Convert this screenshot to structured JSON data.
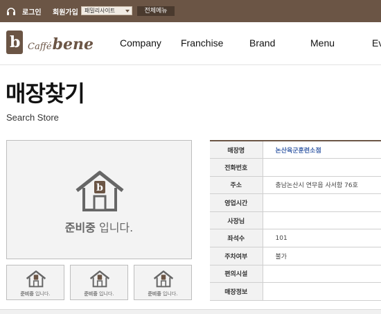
{
  "topbar": {
    "login": "로그인",
    "join": "회원가입",
    "family_select": "패밀리사이트",
    "all_menu": "전체메뉴"
  },
  "brand": {
    "mark": "b",
    "cafe": "Caffé",
    "bene": "bene"
  },
  "nav": [
    "Company",
    "Franchise",
    "Brand",
    "Menu",
    "Ev"
  ],
  "page": {
    "title": "매장찾기",
    "subtitle": "Search Store"
  },
  "placeholder": {
    "bold": "준비중",
    "rest": " 입니다."
  },
  "store_info": [
    {
      "label": "매장명",
      "value": "논산육군훈련소점"
    },
    {
      "label": "전화번호",
      "value": ""
    },
    {
      "label": "주소",
      "value": "충남논산시 연무읍 사서함 76호"
    },
    {
      "label": "영업시간",
      "value": ""
    },
    {
      "label": "사장님",
      "value": ""
    },
    {
      "label": "좌석수",
      "value": "101"
    },
    {
      "label": "주차여부",
      "value": "불가"
    },
    {
      "label": "편의시설",
      "value": ""
    },
    {
      "label": "매장정보",
      "value": ""
    }
  ],
  "colors": {
    "brand_brown": "#6b5545",
    "link_blue": "#3a5fa8"
  }
}
